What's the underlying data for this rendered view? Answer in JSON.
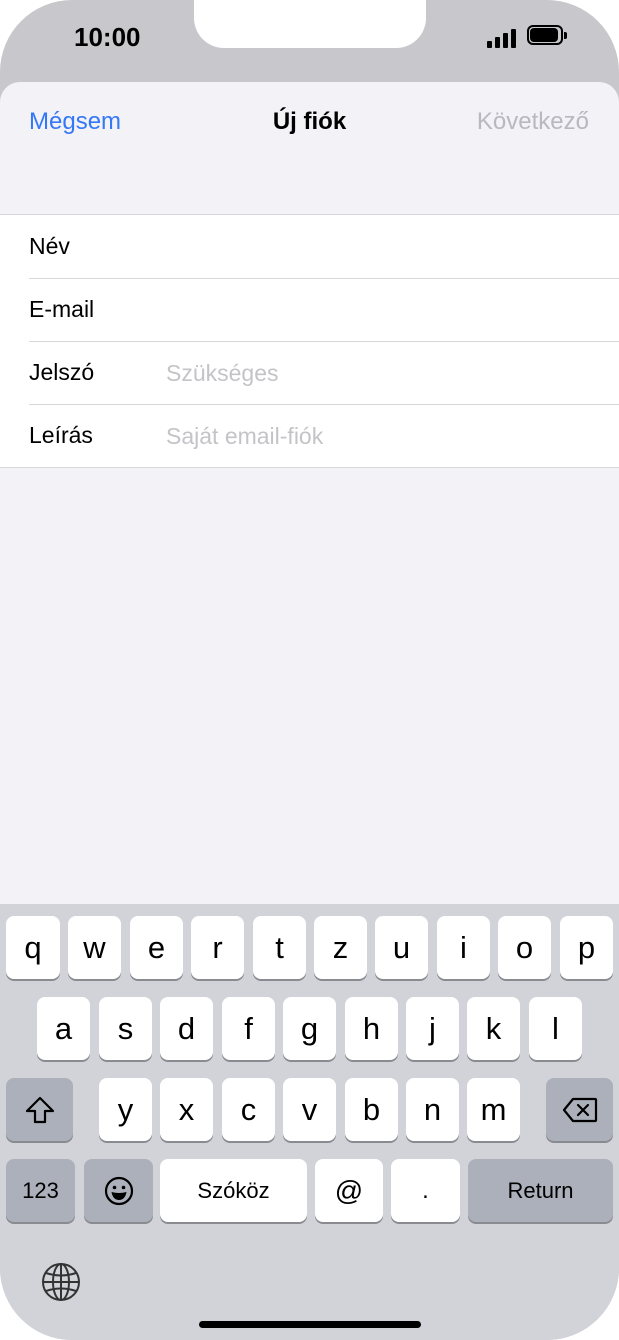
{
  "status_bar": {
    "time": "10:00",
    "icons": [
      "signal-icon",
      "battery-icon"
    ]
  },
  "nav": {
    "cancel": "Mégsem",
    "title": "Új fiók",
    "next": "Következő"
  },
  "colors": {
    "accent": "#3478f6",
    "disabled": "#b8b8be",
    "placeholder": "#c4c4c8"
  },
  "form": {
    "name": {
      "label": "Név",
      "value": "",
      "placeholder": ""
    },
    "email": {
      "label": "E-mail",
      "value": "",
      "placeholder": ""
    },
    "password": {
      "label": "Jelszó",
      "value": "",
      "placeholder": "Szükséges"
    },
    "description": {
      "label": "Leírás",
      "value": "",
      "placeholder": "Saját email-fiók"
    }
  },
  "keyboard": {
    "row1": [
      "q",
      "w",
      "e",
      "r",
      "t",
      "z",
      "u",
      "i",
      "o",
      "p"
    ],
    "row2": [
      "a",
      "s",
      "d",
      "f",
      "g",
      "h",
      "j",
      "k",
      "l"
    ],
    "row3": [
      "y",
      "x",
      "c",
      "v",
      "b",
      "n",
      "m"
    ],
    "numbers": "123",
    "space": "Szóköz",
    "at": "@",
    "dot": ".",
    "return": "Return",
    "icons": [
      "shift-icon",
      "backspace-icon",
      "emoji-icon",
      "globe-icon"
    ]
  }
}
